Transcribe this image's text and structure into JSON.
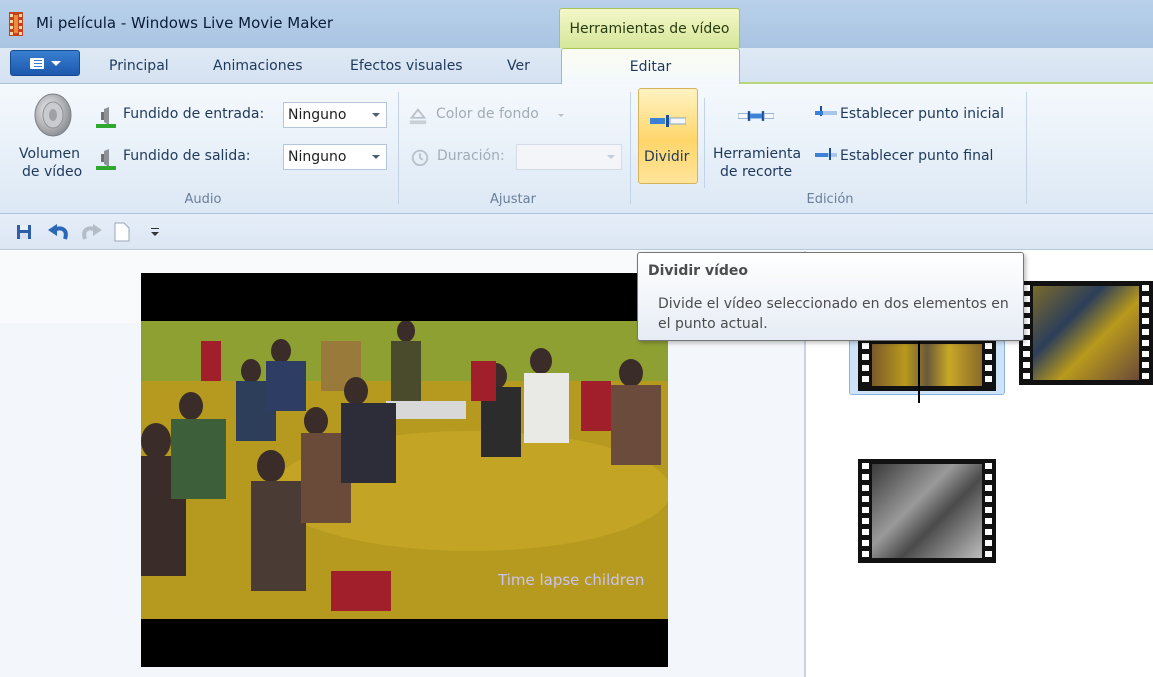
{
  "window": {
    "title": "Mi película - Windows Live Movie Maker",
    "contextual_group": "Herramientas de vídeo"
  },
  "tabs": [
    {
      "label": "Principal"
    },
    {
      "label": "Animaciones"
    },
    {
      "label": "Efectos visuales"
    },
    {
      "label": "Ver"
    },
    {
      "label": "Editar",
      "selected": true
    }
  ],
  "ribbon": {
    "audio": {
      "group_label": "Audio",
      "volume_label_1": "Volumen",
      "volume_label_2": "de vídeo",
      "fade_in_label": "Fundido de entrada:",
      "fade_in_value": "Ninguno",
      "fade_out_label": "Fundido de salida:",
      "fade_out_value": "Ninguno"
    },
    "ajustar": {
      "group_label": "Ajustar",
      "bg_color_label": "Color de fondo",
      "duration_label": "Duración:",
      "duration_value": ""
    },
    "edicion": {
      "group_label": "Edición",
      "split_label": "Dividir",
      "trim_label_1": "Herramienta",
      "trim_label_2": "de recorte",
      "set_start_label": "Establecer punto inicial",
      "set_end_label": "Establecer punto final"
    }
  },
  "quick_access": [
    "save-icon",
    "undo-icon",
    "redo-icon",
    "new-project-icon",
    "customize-dropdown-icon"
  ],
  "preview": {
    "caption": "Time lapse children"
  },
  "tooltip": {
    "title": "Dividir vídeo",
    "body": "Divide el vídeo seleccionado en dos elementos en el punto actual."
  },
  "colors": {
    "accent_blue": "#1c58ad",
    "contextual_green": "#d5e69a",
    "selected_button": "#ffd66b"
  }
}
